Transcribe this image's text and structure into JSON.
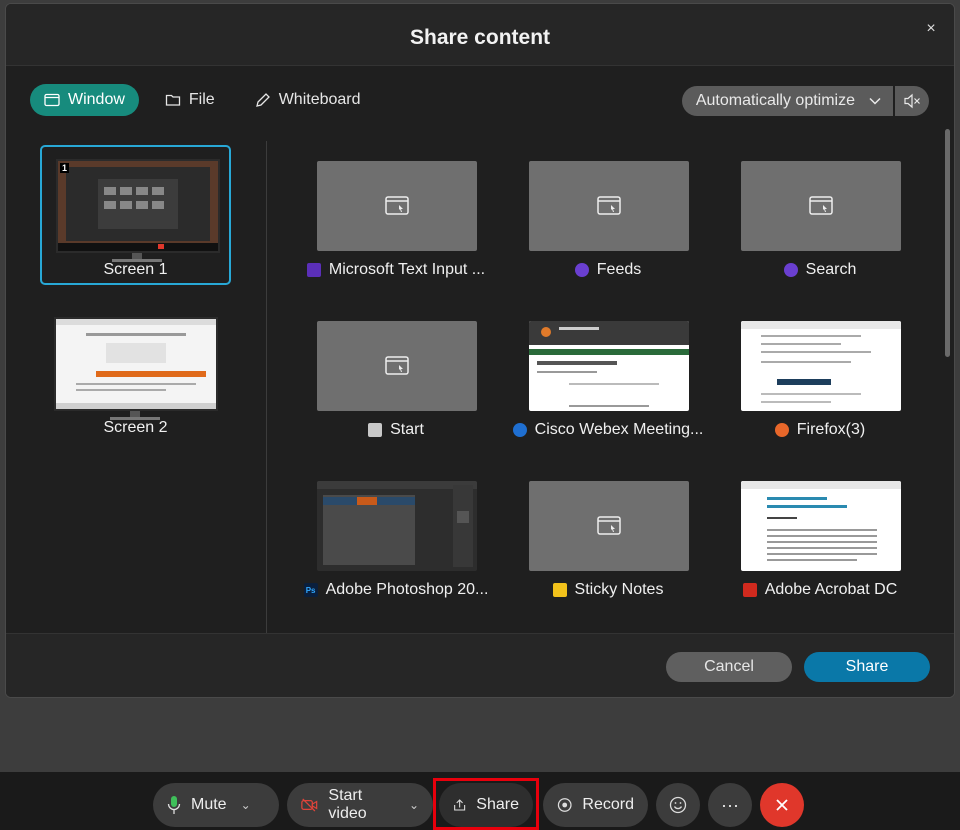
{
  "dialog": {
    "title": "Share content",
    "close_glyph": "×"
  },
  "tabs": [
    {
      "label": "Window",
      "icon": "window-icon",
      "active": true
    },
    {
      "label": "File",
      "icon": "folder-icon",
      "active": false
    },
    {
      "label": "Whiteboard",
      "icon": "pencil-icon",
      "active": false
    }
  ],
  "optimize": {
    "value": "Automatically optimize",
    "icon": "speaker-mute-icon"
  },
  "screens": [
    {
      "label": "Screen 1",
      "number": "1",
      "selected": true
    },
    {
      "label": "Screen 2",
      "selected": false
    }
  ],
  "windows": [
    {
      "label": "Microsoft Text Input ...",
      "icon": "text-input-icon",
      "icon_color": "#5b2fb8",
      "thumb": "placeholder"
    },
    {
      "label": "Feeds",
      "icon": "feeds-icon",
      "icon_color": "#6a3fd0",
      "thumb": "placeholder"
    },
    {
      "label": "Search",
      "icon": "search-icon",
      "icon_color": "#6a3fd0",
      "thumb": "placeholder"
    },
    {
      "label": "Start",
      "icon": "start-icon",
      "icon_color": "#c8c8c8",
      "thumb": "placeholder"
    },
    {
      "label": "Cisco Webex Meeting...",
      "icon": "webex-icon",
      "icon_color": "#1f6fd1",
      "thumb": "webex"
    },
    {
      "label": "Firefox(3)",
      "icon": "firefox-icon",
      "icon_color": "#e8672a",
      "thumb": "firefox"
    },
    {
      "label": "Adobe Photoshop 20...",
      "icon": "photoshop-icon",
      "icon_color": "#0a1f3d",
      "icon_text": "Ps",
      "thumb": "photoshop"
    },
    {
      "label": "Sticky Notes",
      "icon": "sticky-notes-icon",
      "icon_color": "#f2c21b",
      "thumb": "placeholder"
    },
    {
      "label": "Adobe Acrobat DC",
      "icon": "acrobat-icon",
      "icon_color": "#d12a1e",
      "thumb": "acrobat"
    }
  ],
  "footer": {
    "cancel_label": "Cancel",
    "share_label": "Share"
  },
  "toolbar": {
    "mute_label": "Mute",
    "video_label": "Start video",
    "share_label": "Share",
    "record_label": "Record",
    "more_glyph": "···"
  },
  "colors": {
    "accent": "#178b7d",
    "primary": "#0a78a8",
    "end_call": "#e0372b",
    "highlight": "#e8000c"
  }
}
